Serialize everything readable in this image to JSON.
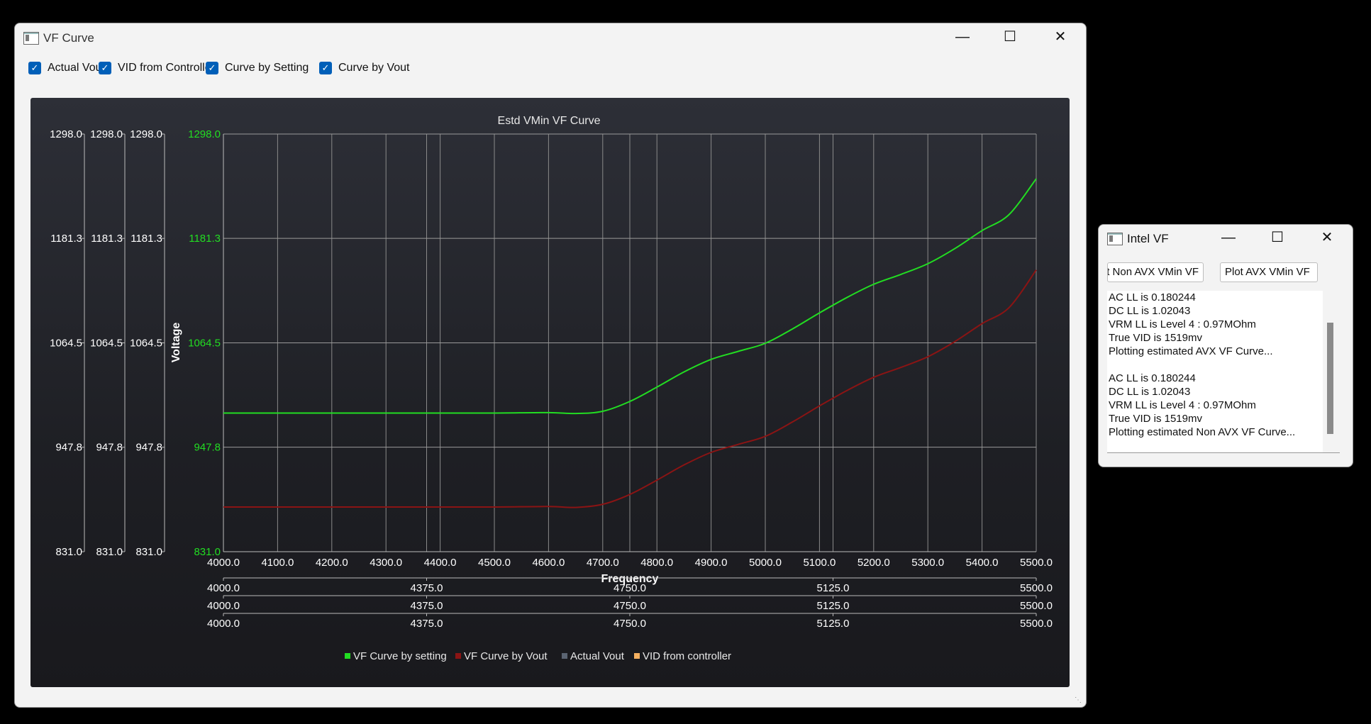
{
  "main_window": {
    "title": "VF Curve",
    "checkboxes": [
      {
        "label": "Actual Vout",
        "checked": true
      },
      {
        "label": "VID from Controller",
        "checked": true
      },
      {
        "label": "Curve by Setting",
        "checked": true
      },
      {
        "label": "Curve by Vout",
        "checked": true
      }
    ]
  },
  "side_window": {
    "title": "Intel VF",
    "btn_non_avx": "Plot Non AVX VMin VF",
    "btn_avx": "Plot AVX VMin VF",
    "log": [
      "AC LL is 0.180244",
      "DC LL is 1.02043",
      "VRM LL is Level 4 : 0.97MOhm",
      "True VID is 1519mv",
      "Plotting estimated AVX VF Curve...",
      "",
      "AC LL is 0.180244",
      "DC LL is 1.02043",
      "VRM LL is Level 4 : 0.97MOhm",
      "True VID is 1519mv",
      "Plotting estimated Non AVX VF Curve..."
    ]
  },
  "chart_data": {
    "type": "line",
    "title": "Estd VMin VF Curve",
    "xlabel": "Frequency",
    "ylabel": "Voltage",
    "xlim": [
      4000,
      5500
    ],
    "ylim": [
      831.0,
      1298.0
    ],
    "grid": true,
    "legend_position": "bottom",
    "x_ticks": [
      "4000.0",
      "4100.0",
      "4200.0",
      "4300.0",
      "4400.0",
      "4500.0",
      "4600.0",
      "4700.0",
      "4800.0",
      "4900.0",
      "5000.0",
      "5100.0",
      "5200.0",
      "5300.0",
      "5400.0",
      "5500.0"
    ],
    "y_ticks": [
      "831.0",
      "947.8",
      "1064.5",
      "1181.3",
      "1298.0"
    ],
    "secondary_x_ticks": [
      "4000.0",
      "4375.0",
      "4750.0",
      "5125.0",
      "5500.0"
    ],
    "extra_vertical_gridlines": [
      4375,
      4750,
      5125
    ],
    "series": [
      {
        "name": "VF Curve by setting",
        "color": "#22dd22",
        "points": [
          [
            4000,
            986
          ],
          [
            4100,
            986
          ],
          [
            4200,
            986
          ],
          [
            4300,
            986
          ],
          [
            4400,
            986
          ],
          [
            4500,
            986
          ],
          [
            4600,
            986.5
          ],
          [
            4650,
            985.5
          ],
          [
            4700,
            988
          ],
          [
            4750,
            999
          ],
          [
            4800,
            1015
          ],
          [
            4850,
            1032
          ],
          [
            4900,
            1046
          ],
          [
            4950,
            1055
          ],
          [
            5000,
            1064
          ],
          [
            5050,
            1080
          ],
          [
            5100,
            1098
          ],
          [
            5150,
            1115
          ],
          [
            5200,
            1130
          ],
          [
            5250,
            1141
          ],
          [
            5300,
            1153
          ],
          [
            5350,
            1170
          ],
          [
            5400,
            1190
          ],
          [
            5450,
            1208
          ],
          [
            5500,
            1248
          ]
        ]
      },
      {
        "name": "VF Curve by Vout",
        "color": "#8b1414",
        "points": [
          [
            4000,
            881
          ],
          [
            4100,
            881
          ],
          [
            4200,
            881
          ],
          [
            4300,
            881
          ],
          [
            4400,
            881
          ],
          [
            4500,
            881
          ],
          [
            4600,
            881.5
          ],
          [
            4650,
            880.5
          ],
          [
            4700,
            884
          ],
          [
            4750,
            895
          ],
          [
            4800,
            911
          ],
          [
            4850,
            928
          ],
          [
            4900,
            942
          ],
          [
            4950,
            951
          ],
          [
            5000,
            960
          ],
          [
            5050,
            976
          ],
          [
            5100,
            994
          ],
          [
            5150,
            1011
          ],
          [
            5200,
            1026
          ],
          [
            5250,
            1037
          ],
          [
            5300,
            1049
          ],
          [
            5350,
            1066
          ],
          [
            5400,
            1086
          ],
          [
            5450,
            1104
          ],
          [
            5500,
            1146
          ]
        ]
      },
      {
        "name": "Actual Vout",
        "color": "#5b6472",
        "points": []
      },
      {
        "name": "VID from controller",
        "color": "#f5b060",
        "points": []
      }
    ]
  }
}
